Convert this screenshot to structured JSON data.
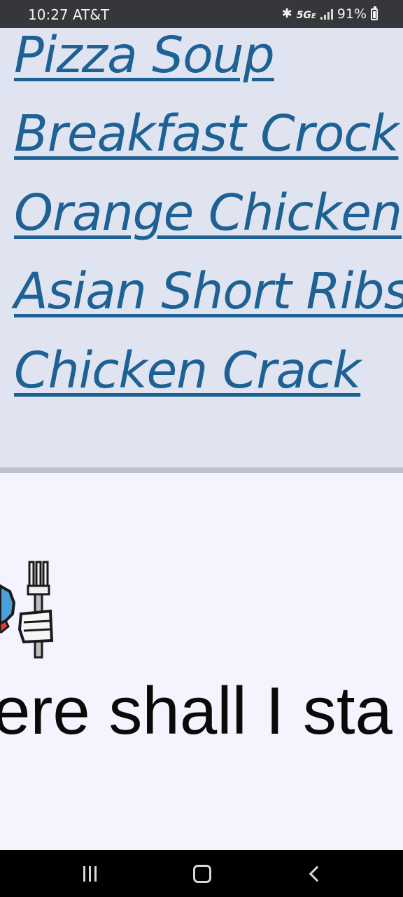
{
  "status_bar": {
    "time_carrier": "10:27 AT&T",
    "network": "5G",
    "network_suffix": "E",
    "battery": "91%",
    "icons": [
      "bluetooth-icon",
      "signal-icon",
      "battery-icon"
    ]
  },
  "recipes": [
    {
      "label": "Pizza Soup"
    },
    {
      "label": "Breakfast Crock"
    },
    {
      "label": "Orange Chicken"
    },
    {
      "label": "Asian Short Ribs"
    },
    {
      "label": "Chicken Crack"
    }
  ],
  "main": {
    "greeting": "ere shall I sta",
    "icon": "plate-fork-icon"
  },
  "nav": {
    "icons": [
      "recents-icon",
      "home-icon",
      "back-icon"
    ]
  },
  "colors": {
    "link": "#1e6194",
    "panel_bg": "#e0e4f1",
    "page_bg": "#f3f4fd",
    "status_bg": "#36373b"
  }
}
